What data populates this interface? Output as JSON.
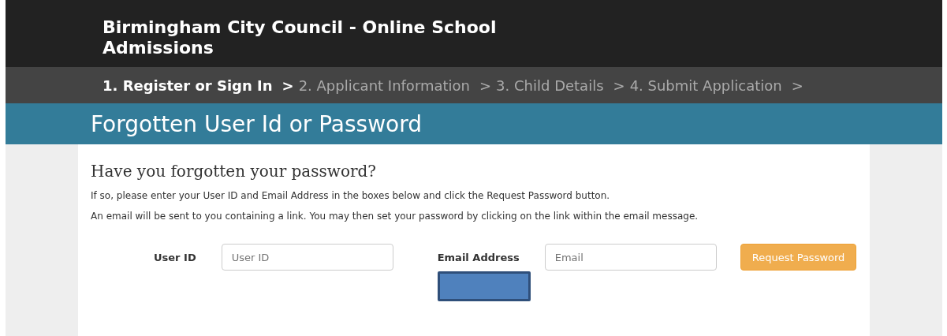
{
  "header": {
    "title": "Birmingham City Council - Online School Admissions"
  },
  "steps": [
    {
      "label": "1. Register or Sign In",
      "separator": ">",
      "selected": true
    },
    {
      "label": "2. Applicant Information",
      "separator": ">",
      "selected": false
    },
    {
      "label": "3. Child Details",
      "separator": ">",
      "selected": false
    },
    {
      "label": "4. Submit Application",
      "separator": ">",
      "selected": false
    }
  ],
  "banner": {
    "title": "Forgotten User Id or Password"
  },
  "content": {
    "heading": "Have you forgotten your password?",
    "paragraphs": [
      "If so, please enter your User ID and Email Address in the boxes below and click the Request Password button.",
      "An email will be sent to you containing a link. You may then set your password by clicking on the link within the email message."
    ]
  },
  "form": {
    "fields": [
      {
        "label": "User ID",
        "placeholder": "User ID"
      },
      {
        "label": "Email Address",
        "placeholder": "Email"
      }
    ],
    "button": "Request Password"
  }
}
